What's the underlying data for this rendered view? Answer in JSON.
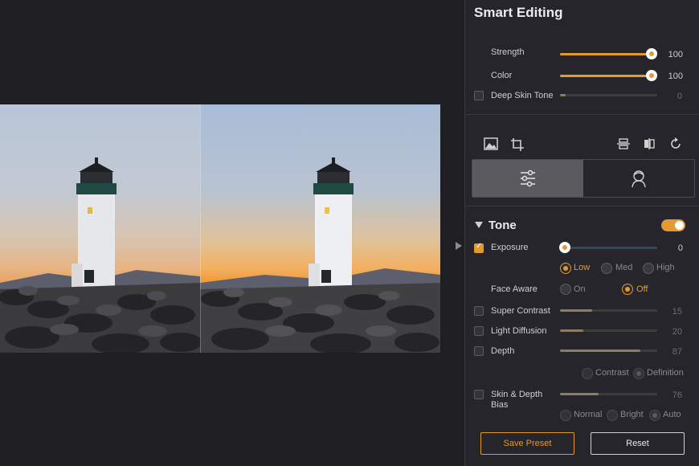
{
  "smart_editing": {
    "title": "Smart Editing",
    "strength": {
      "label": "Strength",
      "value": "100",
      "level": 1.0
    },
    "color": {
      "label": "Color",
      "value": "100",
      "level": 1.0
    },
    "deep_skin_tone": {
      "label": "Deep Skin Tone",
      "value": "0",
      "checked": false,
      "level": 0.0
    }
  },
  "modes": {
    "active": "adjustments",
    "items": [
      "adjustments",
      "portrait"
    ]
  },
  "tone": {
    "title": "Tone",
    "enabled": true,
    "exposure": {
      "label": "Exposure",
      "value": "0",
      "checked": true,
      "level": 0.0,
      "options": [
        {
          "label": "Low",
          "selected": true
        },
        {
          "label": "Med",
          "selected": false
        },
        {
          "label": "High",
          "selected": false
        }
      ]
    },
    "face_aware": {
      "label": "Face Aware",
      "options": [
        {
          "label": "On",
          "selected": false
        },
        {
          "label": "Off",
          "selected": true
        }
      ]
    },
    "super_contrast": {
      "label": "Super Contrast",
      "value": "15",
      "checked": false,
      "level": 0.33
    },
    "light_diffusion": {
      "label": "Light Diffusion",
      "value": "20",
      "checked": false,
      "level": 0.24
    },
    "depth": {
      "label": "Depth",
      "value": "87",
      "checked": false,
      "level": 0.83,
      "options": [
        {
          "label": "Contrast",
          "selected": false
        },
        {
          "label": "Definition",
          "selected": true
        }
      ]
    },
    "skin_depth_bias": {
      "label_line1": "Skin & Depth",
      "label_line2": "Bias",
      "value": "76",
      "checked": false,
      "level": 0.4,
      "options": [
        {
          "label": "Normal",
          "selected": false
        },
        {
          "label": "Bright",
          "selected": false
        },
        {
          "label": "Auto",
          "selected": true
        }
      ]
    }
  },
  "buttons": {
    "save_preset": "Save Preset",
    "reset": "Reset"
  },
  "icons": [
    "image-icon",
    "crop-icon",
    "flip-vertical-icon",
    "compare-icon",
    "rotate-icon",
    "sliders-icon",
    "face-portrait-icon"
  ],
  "colors": {
    "accent": "#e39a35",
    "panel": "#26252b",
    "background": "#1f1e23"
  }
}
